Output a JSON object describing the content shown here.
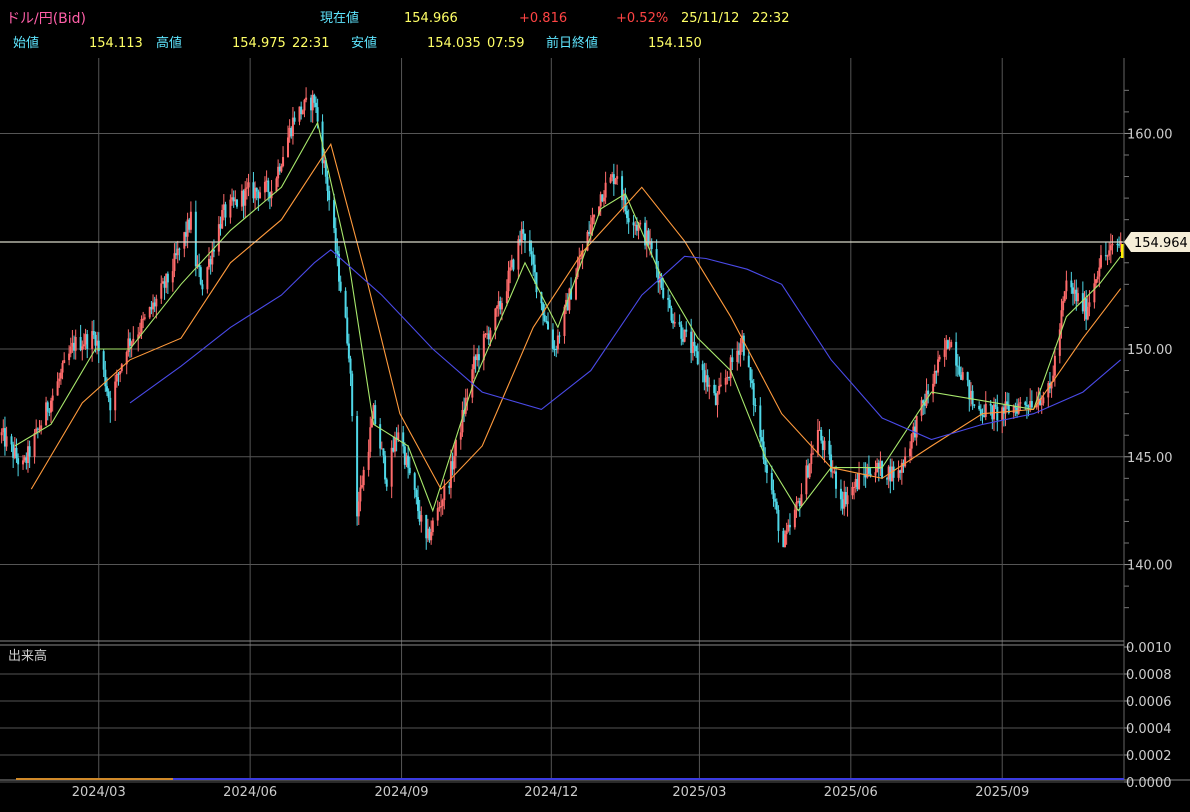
{
  "header": {
    "symbol": "ドル/円(Bid)",
    "current_label": "現在値",
    "current_value": "154.966",
    "change": "+0.816",
    "change_pct": "+0.52%",
    "date": "25/11/12",
    "time": "22:32",
    "open_label": "始値",
    "open_value": "154.113",
    "high_label": "高値",
    "high_value": "154.975",
    "high_time": "22:31",
    "low_label": "安値",
    "low_value": "154.035",
    "low_time": "07:59",
    "prev_close_label": "前日終値",
    "prev_close_value": "154.150"
  },
  "volume_panel": {
    "label": "出来高",
    "ticks": [
      "0.0010",
      "0.0008",
      "0.0006",
      "0.0004",
      "0.0002",
      "0.0000"
    ]
  },
  "colors": {
    "up": "#ff6b6b",
    "down": "#4fd8e8",
    "ma_short": "#a8e86c",
    "ma_mid": "#ff9a3c",
    "ma_long": "#4a4ae8",
    "current_line": "#d8d8c8",
    "grid": "#555555"
  },
  "chart_data": {
    "type": "line",
    "x_ticks": [
      "2024/03",
      "2024/06",
      "2024/09",
      "2024/12",
      "2025/03",
      "2025/06",
      "2025/09"
    ],
    "y_ticks": [
      "160.00",
      "150.00",
      "145.00",
      "140.00"
    ],
    "ylim": [
      136.5,
      163.5
    ],
    "current_price": "154.964",
    "series": [
      {
        "role": "price",
        "x": [
          "2024-01-02",
          "2024-01-15",
          "2024-01-31",
          "2024-02-15",
          "2024-02-28",
          "2024-03-08",
          "2024-03-18",
          "2024-03-29",
          "2024-04-12",
          "2024-04-26",
          "2024-04-29",
          "2024-05-03",
          "2024-05-15",
          "2024-05-31",
          "2024-06-14",
          "2024-06-28",
          "2024-07-10",
          "2024-07-18",
          "2024-07-31",
          "2024-08-05",
          "2024-08-15",
          "2024-08-23",
          "2024-08-30",
          "2024-09-16",
          "2024-09-30",
          "2024-10-15",
          "2024-10-31",
          "2024-11-14",
          "2024-11-27",
          "2024-12-03",
          "2024-12-16",
          "2024-12-31",
          "2025-01-10",
          "2025-01-15",
          "2025-01-29",
          "2025-02-11",
          "2025-02-28",
          "2025-03-11",
          "2025-03-27",
          "2025-04-07",
          "2025-04-21",
          "2025-04-30",
          "2025-05-12",
          "2025-05-27",
          "2025-06-13",
          "2025-06-30",
          "2025-07-14",
          "2025-07-31",
          "2025-08-15",
          "2025-08-29",
          "2025-09-15",
          "2025-09-30",
          "2025-10-10",
          "2025-10-22",
          "2025-10-30",
          "2025-11-12"
        ],
        "y": [
          146.0,
          144.5,
          147.5,
          150.2,
          150.6,
          147.5,
          150.2,
          151.3,
          153.2,
          156.0,
          154.0,
          153.0,
          156.2,
          157.3,
          157.4,
          160.8,
          161.6,
          157.5,
          150.0,
          142.5,
          147.0,
          144.0,
          146.3,
          141.0,
          144.0,
          149.3,
          152.0,
          155.6,
          151.5,
          150.0,
          153.5,
          157.2,
          158.2,
          156.5,
          155.0,
          151.8,
          149.5,
          147.5,
          150.5,
          146.0,
          140.8,
          142.8,
          146.2,
          143.0,
          144.5,
          144.2,
          147.2,
          150.5,
          147.3,
          147.0,
          147.5,
          148.0,
          153.0,
          151.8,
          154.0,
          154.96
        ]
      },
      {
        "name": "",
        "role": "ma_short",
        "x": [
          "2024-01-10",
          "2024-02-01",
          "2024-02-28",
          "2024-03-20",
          "2024-04-20",
          "2024-05-20",
          "2024-06-20",
          "2024-07-12",
          "2024-07-31",
          "2024-08-15",
          "2024-09-05",
          "2024-09-20",
          "2024-10-15",
          "2024-11-15",
          "2024-12-05",
          "2024-12-31",
          "2025-01-15",
          "2025-02-05",
          "2025-02-28",
          "2025-03-20",
          "2025-04-10",
          "2025-04-30",
          "2025-05-20",
          "2025-06-20",
          "2025-07-20",
          "2025-08-20",
          "2025-09-20",
          "2025-10-10",
          "2025-10-30",
          "2025-11-12"
        ],
        "y": [
          145.5,
          146.5,
          150.0,
          150.0,
          153.0,
          155.5,
          157.5,
          160.5,
          154.0,
          146.5,
          145.5,
          142.5,
          148.5,
          154.0,
          151.0,
          156.5,
          157.2,
          153.5,
          150.5,
          149.0,
          145.0,
          142.5,
          144.5,
          144.5,
          148.0,
          147.6,
          147.2,
          151.5,
          153.0,
          154.3
        ]
      },
      {
        "name": "",
        "role": "ma_mid",
        "x": [
          "2024-01-20",
          "2024-02-20",
          "2024-03-20",
          "2024-04-20",
          "2024-05-20",
          "2024-06-20",
          "2024-07-20",
          "2024-08-10",
          "2024-08-31",
          "2024-09-25",
          "2024-10-20",
          "2024-11-20",
          "2024-12-20",
          "2025-01-25",
          "2025-02-20",
          "2025-03-20",
          "2025-04-20",
          "2025-05-20",
          "2025-06-20",
          "2025-07-20",
          "2025-08-20",
          "2025-09-20",
          "2025-10-20",
          "2025-11-12"
        ],
        "y": [
          143.5,
          147.5,
          149.5,
          150.5,
          154.0,
          156.0,
          159.5,
          153.5,
          147.0,
          143.5,
          145.5,
          151.0,
          154.5,
          157.5,
          155.0,
          151.5,
          147.0,
          144.5,
          144.0,
          145.5,
          147.0,
          147.2,
          150.5,
          152.8
        ]
      },
      {
        "name": "",
        "role": "ma_long",
        "x": [
          "2024-03-20",
          "2024-04-20",
          "2024-05-20",
          "2024-06-20",
          "2024-07-10",
          "2024-07-20",
          "2024-08-20",
          "2024-09-20",
          "2024-10-20",
          "2024-11-25",
          "2024-12-25",
          "2025-01-25",
          "2025-02-20",
          "2025-03-05",
          "2025-03-30",
          "2025-04-20",
          "2025-05-20",
          "2025-06-20",
          "2025-07-20",
          "2025-08-20",
          "2025-09-20",
          "2025-10-20",
          "2025-11-12"
        ],
        "y": [
          147.5,
          149.2,
          151.0,
          152.5,
          154.0,
          154.6,
          152.5,
          150.0,
          148.0,
          147.2,
          149.0,
          152.5,
          154.3,
          154.2,
          153.7,
          153.0,
          149.5,
          146.8,
          145.8,
          146.5,
          147.0,
          148.0,
          149.5
        ]
      }
    ]
  }
}
